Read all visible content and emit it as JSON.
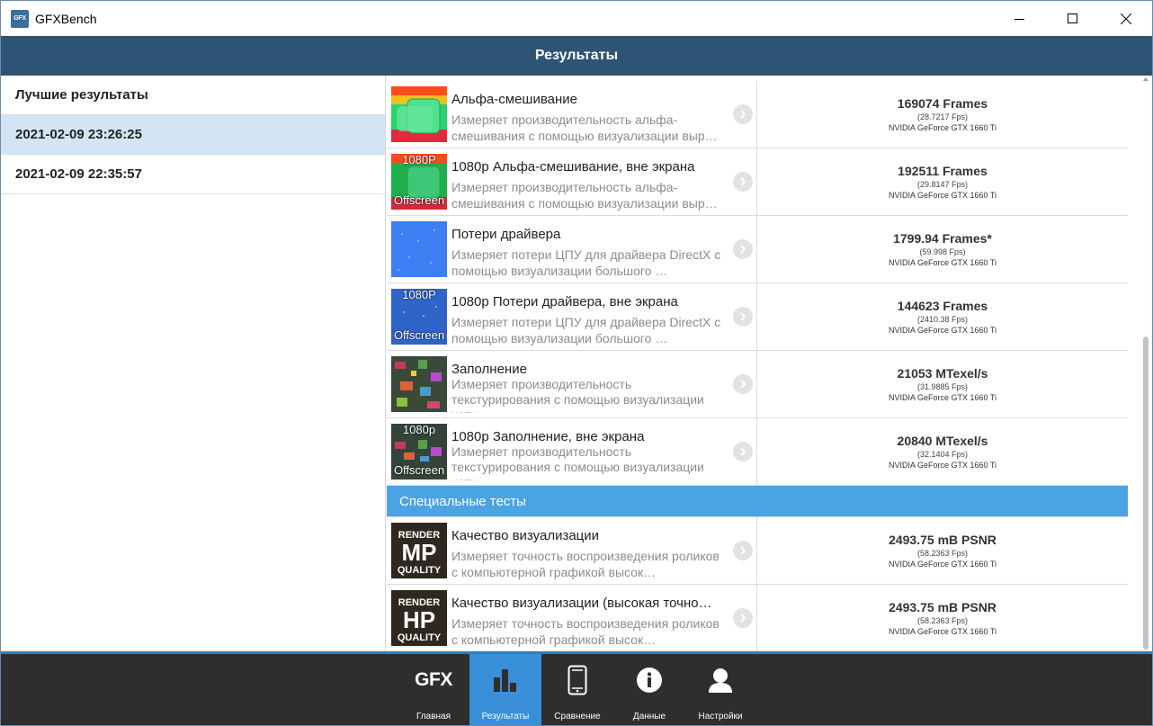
{
  "window": {
    "title": "GFXBench",
    "icon_text": "GFX"
  },
  "header": {
    "title": "Результаты"
  },
  "sidebar": {
    "items": [
      {
        "label": "Лучшие результаты"
      },
      {
        "label": "2021-02-09 23:26:25"
      },
      {
        "label": "2021-02-09 22:35:57"
      }
    ]
  },
  "results": [
    {
      "title": "Альфа-смешивание",
      "desc": "Измеряет производительность альфа-смешивания с помощью визуализации выр…",
      "score": "169074 Frames",
      "fps": "(28.7217 Fps)",
      "gpu": "NVIDIA GeForce GTX 1660 Ti",
      "thumb": "alpha",
      "thumb_top": "",
      "thumb_bottom": ""
    },
    {
      "title": "1080p Альфа-смешивание, вне экрана",
      "desc": "Измеряет производительность альфа-смешивания с помощью визуализации выр…",
      "score": "192511 Frames",
      "fps": "(29.8147 Fps)",
      "gpu": "NVIDIA GeForce GTX 1660 Ti",
      "thumb": "alpha",
      "thumb_top": "1080P",
      "thumb_bottom": "Offscreen"
    },
    {
      "title": "Потери драйвера",
      "desc": "Измеряет потери ЦПУ для драйвера DirectX с помощью визуализации большого …",
      "score": "1799.94 Frames*",
      "fps": "(59.998 Fps)",
      "gpu": "NVIDIA GeForce GTX 1660 Ti",
      "thumb": "driver",
      "thumb_top": "",
      "thumb_bottom": ""
    },
    {
      "title": "1080p Потери драйвера, вне экрана",
      "desc": "Измеряет потери ЦПУ для драйвера DirectX с помощью визуализации большого …",
      "score": "144623 Frames",
      "fps": "(2410.38 Fps)",
      "gpu": "NVIDIA GeForce GTX 1660 Ti",
      "thumb": "driver-dark",
      "thumb_top": "1080P",
      "thumb_bottom": "Offscreen"
    },
    {
      "title": "Заполнение",
      "desc": "Измеряет производительность текстурирования с помощью визуализации четы…",
      "score": "21053 MTexel/s",
      "fps": "(31.9885 Fps)",
      "gpu": "NVIDIA GeForce GTX 1660 Ti",
      "thumb": "fill",
      "thumb_top": "",
      "thumb_bottom": ""
    },
    {
      "title": "1080p Заполнение, вне экрана",
      "desc": "Измеряет производительность текстурирования с помощью визуализации четы…",
      "score": "20840 MTexel/s",
      "fps": "(32.1404 Fps)",
      "gpu": "NVIDIA GeForce GTX 1660 Ti",
      "thumb": "fill",
      "thumb_top": "1080p",
      "thumb_bottom": "Offscreen"
    }
  ],
  "section": {
    "title": "Специальные тесты"
  },
  "special": [
    {
      "title": "Качество визуализации",
      "desc": "Измеряет точность воспроизведения роликов с компьютерной графикой высок…",
      "score": "2493.75 mB PSNR",
      "fps": "(58.2363 Fps)",
      "gpu": "NVIDIA GeForce GTX 1660 Ti",
      "badge_top": "RENDER",
      "badge_main": "MP",
      "badge_bottom": "QUALITY"
    },
    {
      "title": "Качество визуализации (высокая точно…",
      "desc": "Измеряет точность воспроизведения роликов с компьютерной графикой высок…",
      "score": "2493.75 mB PSNR",
      "fps": "(58.2363 Fps)",
      "gpu": "NVIDIA GeForce GTX 1660 Ti",
      "badge_top": "RENDER",
      "badge_main": "HP",
      "badge_bottom": "QUALITY"
    }
  ],
  "nav": {
    "logo_text": "GFX",
    "items": [
      {
        "label": "Главная",
        "icon": "gfx-logo"
      },
      {
        "label": "Результаты",
        "icon": "bar-chart-icon"
      },
      {
        "label": "Сравнение",
        "icon": "phone-icon"
      },
      {
        "label": "Данные",
        "icon": "info-icon"
      },
      {
        "label": "Настройки",
        "icon": "user-icon"
      }
    ]
  },
  "colors": {
    "header": "#2d5475",
    "accent": "#3a8fd9",
    "section": "#4ba3e3",
    "nav": "#2e2e2e",
    "selected": "#d3e4f5"
  }
}
